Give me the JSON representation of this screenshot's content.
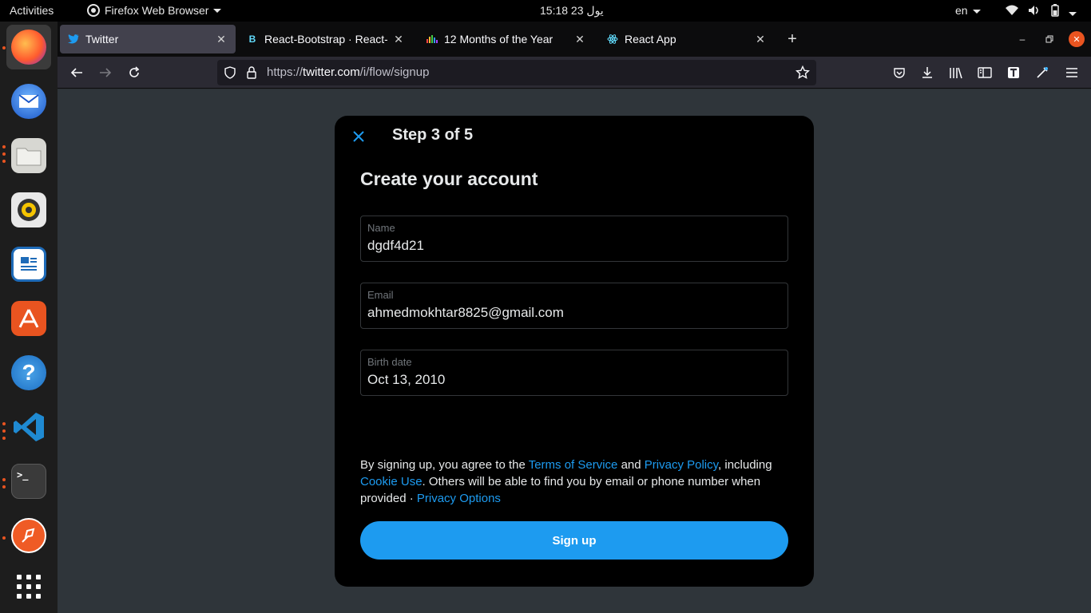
{
  "topbar": {
    "activities": "Activities",
    "app_name": "Firefox Web Browser",
    "clock": "15:18  23 يول",
    "lang": "en"
  },
  "dock": {
    "apps": [
      {
        "name": "firefox-icon"
      },
      {
        "name": "thunderbird-icon"
      },
      {
        "name": "files-icon"
      },
      {
        "name": "rhythmbox-icon"
      },
      {
        "name": "libreoffice-writer-icon"
      },
      {
        "name": "software-center-icon"
      },
      {
        "name": "help-icon"
      },
      {
        "name": "vscode-icon"
      },
      {
        "name": "terminal-icon"
      },
      {
        "name": "postman-icon"
      },
      {
        "name": "show-apps-icon"
      }
    ]
  },
  "tabs": [
    {
      "title": "Twitter",
      "icon": "twitter-icon"
    },
    {
      "title": "React-Bootstrap · React-B",
      "icon": "react-bootstrap-icon"
    },
    {
      "title": "12 Months of the Year",
      "icon": "colorful-dots-icon"
    },
    {
      "title": "React App",
      "icon": "react-icon"
    }
  ],
  "navbar": {
    "url_prefix": "https://",
    "url_host": "twitter.com",
    "url_path": "/i/flow/signup"
  },
  "modal": {
    "step": "Step 3 of 5",
    "heading": "Create your account",
    "fields": {
      "name_label": "Name",
      "name_value": "dgdf4d21",
      "email_label": "Email",
      "email_value": "ahmedmokhtar8825@gmail.com",
      "birth_label": "Birth date",
      "birth_value": "Oct 13, 2010"
    },
    "terms": {
      "t1": "By signing up, you agree to the ",
      "tos": "Terms of Service",
      "t2": " and ",
      "privacy": "Privacy Policy",
      "t3": ", including ",
      "cookie": "Cookie Use",
      "t4": ". Others will be able to find you by email or phone number when provided · ",
      "privacy_options": "Privacy Options"
    },
    "signup_label": "Sign up"
  },
  "colors": {
    "accent": "#1d9bf0",
    "modal_bg": "#000000",
    "page_bg": "#2f353a"
  }
}
